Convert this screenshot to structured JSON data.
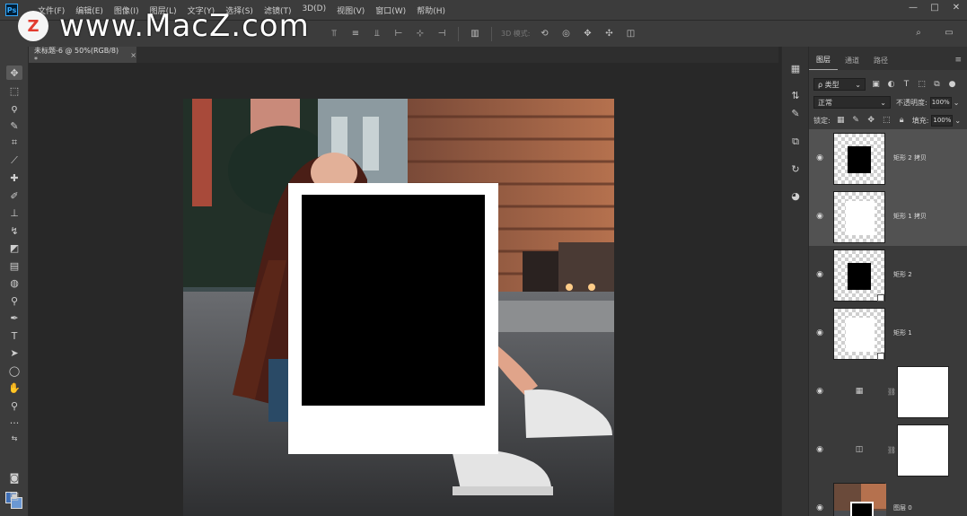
{
  "app": {
    "logo": "Ps"
  },
  "menu": [
    "文件(F)",
    "编辑(E)",
    "图像(I)",
    "图层(L)",
    "文字(Y)",
    "选择(S)",
    "滤镜(T)",
    "3D(D)",
    "视图(V)",
    "窗口(W)",
    "帮助(H)"
  ],
  "window_controls": {
    "minimize": "—",
    "restore": "□",
    "close": "✕"
  },
  "options": {
    "mode_3d": "3D 模式:"
  },
  "watermark": {
    "badge": "Z",
    "text": "www.MacZ.com"
  },
  "document_tab": {
    "title": "未标题-6 @ 50%(RGB/8) *",
    "close": "×"
  },
  "layers_panel": {
    "tabs": [
      "图层",
      "通道",
      "路径"
    ],
    "active_tab": "图层",
    "filter_label": "ρ 类型",
    "blend_mode": "正常",
    "opacity_label": "不透明度:",
    "opacity_value": "100%",
    "lock_label": "锁定:",
    "fill_label": "填充:",
    "fill_value": "100%",
    "layers": [
      {
        "name": "矩形 2 拷贝",
        "thumb": "black",
        "selected": true
      },
      {
        "name": "矩形 1 拷贝",
        "thumb": "white",
        "selected": true
      },
      {
        "name": "矩形 2",
        "thumb": "black",
        "selected": false
      },
      {
        "name": "矩形 1",
        "thumb": "white",
        "selected": false
      },
      {
        "name": "",
        "thumb": "adjustment-levels",
        "selected": false
      },
      {
        "name": "",
        "thumb": "adjustment-curves",
        "selected": false
      },
      {
        "name": "图层 0",
        "thumb": "photo",
        "selected": false
      }
    ]
  },
  "colors": {
    "foreground": "#3f6fb5",
    "background": "#6a98d4",
    "accent": "#31a8ff"
  }
}
